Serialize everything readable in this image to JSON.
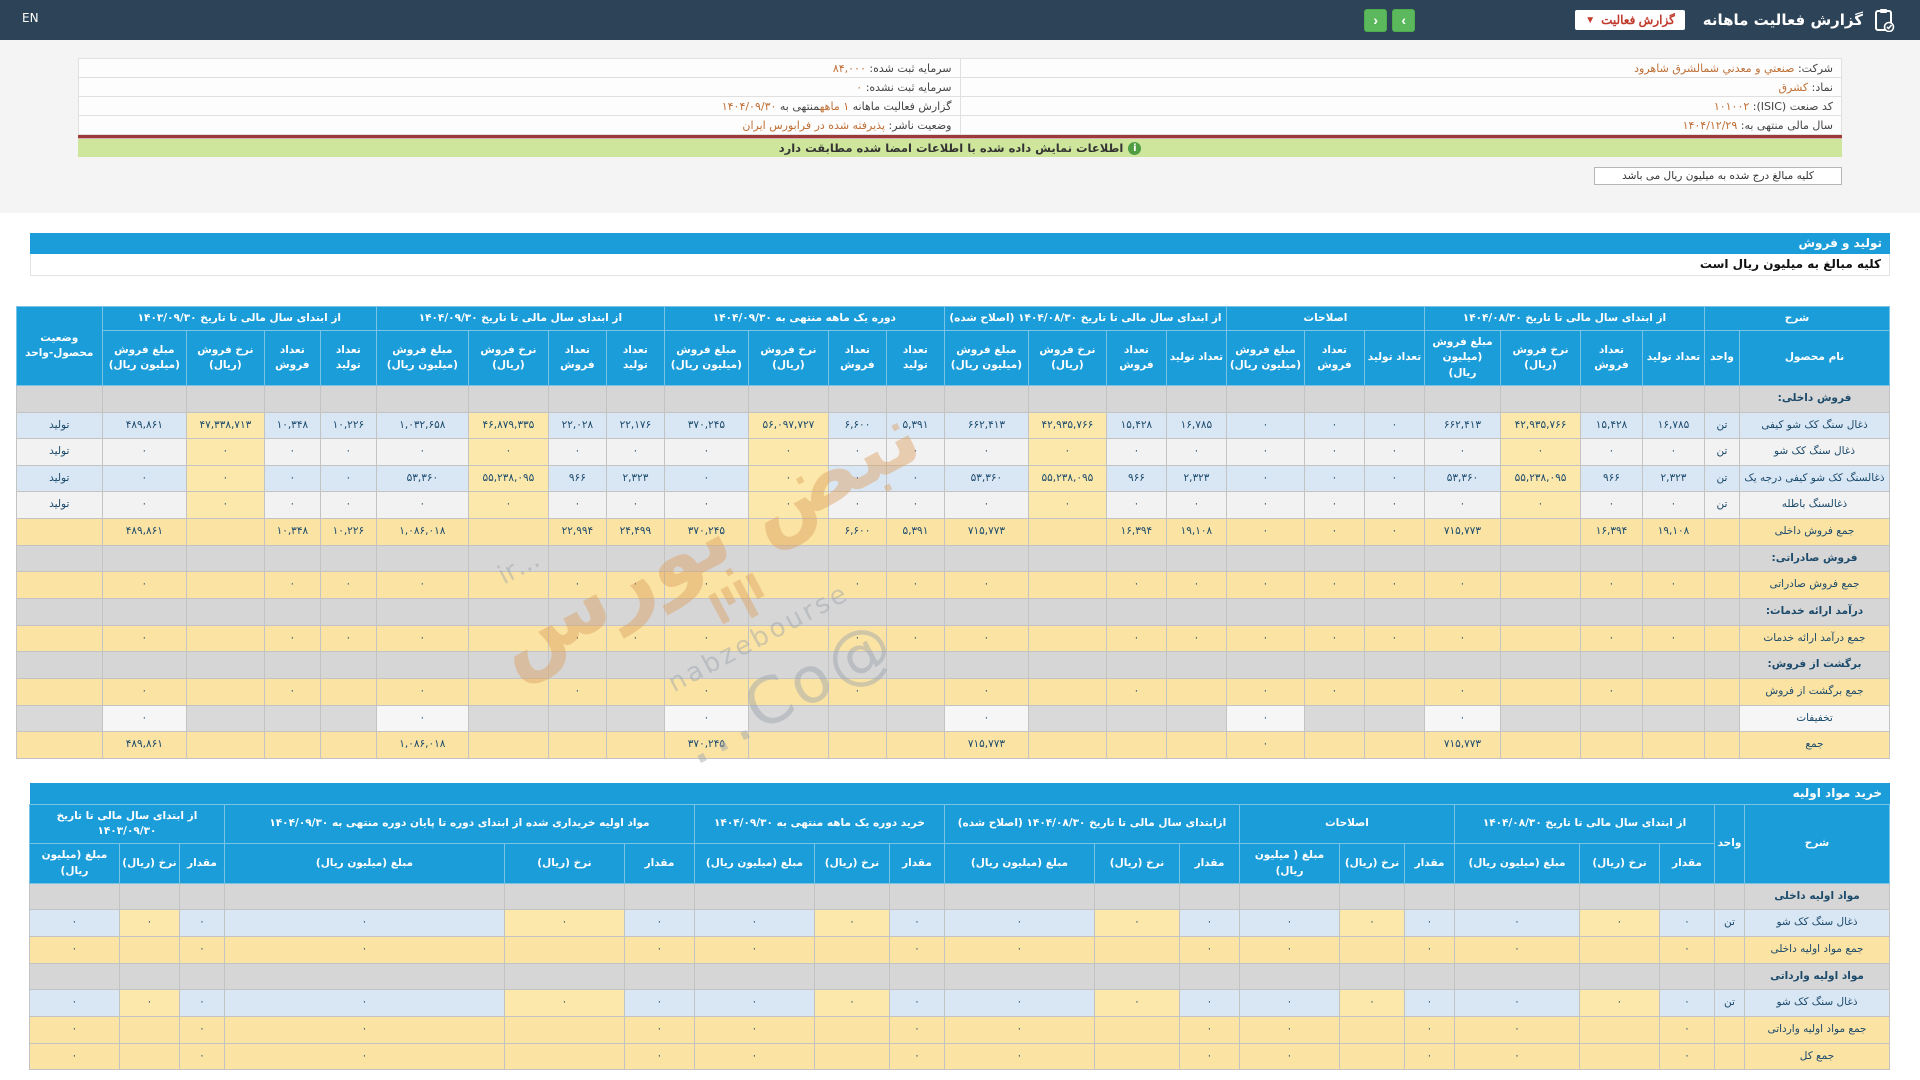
{
  "topbar": {
    "title": "گزارش فعالیت ماهانه",
    "dropdown_label": "گزارش فعالیت",
    "en_label": "EN",
    "next_label": "›",
    "prev_label": "‹"
  },
  "info": {
    "rows": [
      {
        "right": [
          [
            "شرکت:  ",
            0
          ],
          [
            "صنعتي و معدني شمالشرق شاهرود",
            1
          ]
        ],
        "left": [
          [
            "سرمایه ثبت شده:  ",
            0
          ],
          [
            "۸۴,۰۰۰",
            1
          ]
        ]
      },
      {
        "right": [
          [
            "نماد:  ",
            0
          ],
          [
            "کشرق",
            1
          ]
        ],
        "left": [
          [
            "سرمایه ثبت نشده:  ",
            0
          ],
          [
            "۰",
            1
          ]
        ]
      },
      {
        "right": [
          [
            "کد صنعت (ISIC):  ",
            0
          ],
          [
            "۱۰۱۰۰۲",
            1
          ]
        ],
        "left": [
          [
            "گزارش فعالیت ماهانه ",
            0
          ],
          [
            "۱ ماهه",
            1
          ],
          [
            "منتهی به ",
            0
          ],
          [
            "۱۴۰۴/۰۹/۳۰",
            1
          ]
        ]
      },
      {
        "right": [
          [
            "سال مالی منتهی به:  ",
            0
          ],
          [
            "۱۴۰۴/۱۲/۲۹",
            1
          ]
        ],
        "left": [
          [
            "وضعیت ناشر:  ",
            0
          ],
          [
            "پذیرفته شده در فرابورس ایران",
            1
          ]
        ]
      }
    ]
  },
  "notices": {
    "signed": "اطلاعات نمایش داده شده با اطلاعات امضا شده مطابقت دارد",
    "info_icon": "i",
    "unit_box": "کلیه مبالغ درج شده به میلیون ریال می باشد"
  },
  "watermark": {
    "ir": "...ir",
    "fa": "نبض بورس",
    "en": "nabzebourse",
    "at": "@Co..."
  },
  "tables": [
    {
      "title": "تولید و فروش",
      "subtitle": "کلیه مبالغ به میلیون ریال است",
      "has_status": true,
      "ncols": 23,
      "rate_cols": [
        2,
        9,
        13,
        17,
        21
      ],
      "amount_cols": [
        3,
        6,
        10,
        14,
        18,
        22
      ],
      "widths": [
        150,
        35,
        62,
        62,
        80,
        76,
        60,
        60,
        78,
        60,
        60,
        78,
        84,
        58,
        58,
        80,
        84,
        58,
        58,
        80,
        92,
        56,
        56,
        78,
        84,
        86
      ],
      "header": [
        [
          {
            "t": "شرح",
            "cs": 2
          },
          {
            "t": "از ابتدای سال مالی تا تاریخ ۱۴۰۴/۰۸/۳۰",
            "cs": 4
          },
          {
            "t": "اصلاحات",
            "cs": 3
          },
          {
            "t": "از ابتدای سال مالی تا تاریخ ۱۴۰۴/۰۸/۳۰ (اصلاح شده)",
            "cs": 4
          },
          {
            "t": "دوره یک ماهه منتهی به ۱۴۰۴/۰۹/۳۰",
            "cs": 4
          },
          {
            "t": "از ابتدای سال مالی تا تاریخ ۱۴۰۴/۰۹/۳۰",
            "cs": 4
          },
          {
            "t": "از ابتدای سال مالی تا تاریخ ۱۴۰۳/۰۹/۳۰",
            "cs": 4
          },
          {
            "t": "وضعیت محصول-واحد",
            "rs": 2
          }
        ],
        [
          {
            "t": "نام محصول"
          },
          {
            "t": "واحد"
          },
          {
            "t": "تعداد تولید"
          },
          {
            "t": "تعداد فروش"
          },
          {
            "t": "نرخ فروش (ریال)"
          },
          {
            "t": "مبلغ فروش (میلیون ریال)"
          },
          {
            "t": "تعداد تولید"
          },
          {
            "t": "تعداد فروش"
          },
          {
            "t": "مبلغ فروش (میلیون ریال)"
          },
          {
            "t": "تعداد تولید"
          },
          {
            "t": "تعداد فروش"
          },
          {
            "t": "نرخ فروش (ریال)"
          },
          {
            "t": "مبلغ فروش (میلیون ریال)"
          },
          {
            "t": "تعداد تولید"
          },
          {
            "t": "تعداد فروش"
          },
          {
            "t": "نرخ فروش (ریال)"
          },
          {
            "t": "مبلغ فروش (میلیون ریال)"
          },
          {
            "t": "تعداد تولید"
          },
          {
            "t": "تعداد فروش"
          },
          {
            "t": "نرخ فروش (ریال)"
          },
          {
            "t": "مبلغ فروش (میلیون ریال)"
          },
          {
            "t": "تعداد تولید"
          },
          {
            "t": "تعداد فروش"
          },
          {
            "t": "نرخ فروش (ریال)"
          },
          {
            "t": "مبلغ فروش (میلیون ریال)"
          }
        ]
      ],
      "rows": [
        {
          "type": "section",
          "label": "فروش داخلی:"
        },
        {
          "type": "product",
          "shade": "b",
          "name": "ذغال سنگ کک شو کیفی",
          "unit": "تن",
          "status": "تولید",
          "cells": [
            "۱۶,۷۸۵",
            "۱۵,۴۲۸",
            "۴۲,۹۳۵,۷۶۶",
            "۶۶۲,۴۱۳",
            "۰",
            "۰",
            "۰",
            "۱۶,۷۸۵",
            "۱۵,۴۲۸",
            "۴۲,۹۳۵,۷۶۶",
            "۶۶۲,۴۱۳",
            "۵,۳۹۱",
            "۶,۶۰۰",
            "۵۶,۰۹۷,۷۲۷",
            "۳۷۰,۲۴۵",
            "۲۲,۱۷۶",
            "۲۲,۰۲۸",
            "۴۶,۸۷۹,۳۳۵",
            "۱,۰۳۲,۶۵۸",
            "۱۰,۲۲۶",
            "۱۰,۳۴۸",
            "۴۷,۳۳۸,۷۱۳",
            "۴۸۹,۸۶۱"
          ]
        },
        {
          "type": "product",
          "shade": "a",
          "name": "ذغال سنگ کک شو",
          "unit": "تن",
          "status": "تولید",
          "cells": [
            "۰",
            "۰",
            "۰",
            "۰",
            "۰",
            "۰",
            "۰",
            "۰",
            "۰",
            "۰",
            "۰",
            "۰",
            "۰",
            "۰",
            "۰",
            "۰",
            "۰",
            "۰",
            "۰",
            "۰",
            "۰",
            "۰",
            "۰"
          ]
        },
        {
          "type": "product",
          "shade": "b",
          "name": "ذغالسنگ کک شو کیفی درجه یک",
          "unit": "تن",
          "status": "تولید",
          "cells": [
            "۲,۳۲۳",
            "۹۶۶",
            "۵۵,۲۳۸,۰۹۵",
            "۵۳,۳۶۰",
            "۰",
            "۰",
            "۰",
            "۲,۳۲۳",
            "۹۶۶",
            "۵۵,۲۳۸,۰۹۵",
            "۵۳,۳۶۰",
            "۰",
            "۰",
            "۰",
            "۰",
            "۲,۳۲۳",
            "۹۶۶",
            "۵۵,۲۳۸,۰۹۵",
            "۵۳,۳۶۰",
            "۰",
            "۰",
            "۰",
            "۰"
          ]
        },
        {
          "type": "product",
          "shade": "a",
          "name": "ذغالسنگ باطله",
          "unit": "تن",
          "status": "تولید",
          "cells": [
            "۰",
            "۰",
            "۰",
            "۰",
            "۰",
            "۰",
            "۰",
            "۰",
            "۰",
            "۰",
            "۰",
            "۰",
            "۰",
            "۰",
            "۰",
            "۰",
            "۰",
            "۰",
            "۰",
            "۰",
            "۰",
            "۰",
            "۰"
          ]
        },
        {
          "type": "sum",
          "name": "جمع فروش داخلی",
          "cells": [
            "۱۹,۱۰۸",
            "۱۶,۳۹۴",
            "",
            "۷۱۵,۷۷۳",
            "۰",
            "۰",
            "۰",
            "۱۹,۱۰۸",
            "۱۶,۳۹۴",
            "",
            "۷۱۵,۷۷۳",
            "۵,۳۹۱",
            "۶,۶۰۰",
            "",
            "۳۷۰,۲۴۵",
            "۲۴,۴۹۹",
            "۲۲,۹۹۴",
            "",
            "۱,۰۸۶,۰۱۸",
            "۱۰,۲۲۶",
            "۱۰,۳۴۸",
            "",
            "۴۸۹,۸۶۱"
          ]
        },
        {
          "type": "section",
          "label": "فروش صادراتی:"
        },
        {
          "type": "sum",
          "name": "جمع فروش صادراتی",
          "cells": [
            "۰",
            "۰",
            "",
            "۰",
            "۰",
            "۰",
            "۰",
            "۰",
            "۰",
            "",
            "۰",
            "۰",
            "۰",
            "",
            "۰",
            "۰",
            "۰",
            "",
            "۰",
            "۰",
            "۰",
            "",
            "۰"
          ]
        },
        {
          "type": "section",
          "label": "درآمد ارائه خدمات:"
        },
        {
          "type": "sum",
          "name": "جمع درآمد ارائه خدمات",
          "cells": [
            "۰",
            "۰",
            "",
            "۰",
            "۰",
            "۰",
            "۰",
            "۰",
            "۰",
            "",
            "۰",
            "۰",
            "۰",
            "",
            "۰",
            "۰",
            "۰",
            "",
            "۰",
            "۰",
            "۰",
            "",
            "۰"
          ]
        },
        {
          "type": "section",
          "label": "برگشت از فروش:"
        },
        {
          "type": "sum",
          "name": "جمع برگشت از فروش",
          "cells": [
            "",
            "۰",
            "",
            "۰",
            "",
            "۰",
            "۰",
            "",
            "۰",
            "",
            "۰",
            "",
            "۰",
            "",
            "۰",
            "",
            "۰",
            "",
            "۰",
            "",
            "۰",
            "",
            "۰"
          ]
        },
        {
          "type": "disc",
          "name": "تخفیفات",
          "cells": [
            "",
            "",
            "",
            "۰",
            "",
            "",
            "۰",
            "",
            "",
            "",
            "۰",
            "",
            "",
            "",
            "۰",
            "",
            "",
            "",
            "۰",
            "",
            "",
            "",
            "۰"
          ]
        },
        {
          "type": "sum",
          "name": "جمع",
          "cells": [
            "",
            "",
            "",
            "۷۱۵,۷۷۳",
            "",
            "",
            "۰",
            "",
            "",
            "",
            "۷۱۵,۷۷۳",
            "",
            "",
            "",
            "۳۷۰,۲۴۵",
            "",
            "",
            "",
            "۱,۰۸۶,۰۱۸",
            "",
            "",
            "",
            "۴۸۹,۸۶۱"
          ]
        }
      ]
    },
    {
      "title": "خرید مواد اولیه",
      "subtitle": "",
      "has_status": false,
      "ncols": 18,
      "rate_cols": [
        1,
        4,
        7,
        10,
        13,
        16
      ],
      "amount_cols": [
        2,
        5,
        8,
        11,
        14,
        17
      ],
      "widths": [
        145,
        30,
        55,
        80,
        125,
        50,
        65,
        100,
        60,
        85,
        150,
        55,
        75,
        120,
        70,
        120,
        280,
        45,
        60,
        90
      ],
      "header": [
        [
          {
            "t": "شرح",
            "rs": 2
          },
          {
            "t": "واحد",
            "rs": 2
          },
          {
            "t": "از ابتدای سال مالی تا تاریخ ۱۴۰۴/۰۸/۳۰",
            "cs": 3
          },
          {
            "t": "اصلاحات",
            "cs": 3
          },
          {
            "t": "ازابتدای سال مالی تا تاریخ ۱۴۰۴/۰۸/۳۰ (اصلاح شده)",
            "cs": 3
          },
          {
            "t": "خرید دوره یک ماهه منتهی به ۱۴۰۴/۰۹/۳۰",
            "cs": 3
          },
          {
            "t": "مواد اولیه خریداری شده از ابتدای دوره تا پایان دوره منتهی به ۱۴۰۴/۰۹/۳۰",
            "cs": 3
          },
          {
            "t": "از ابتدای سال مالی تا تاریخ ۱۴۰۳/۰۹/۳۰",
            "cs": 3
          }
        ],
        [
          {
            "t": "مقدار"
          },
          {
            "t": "نرخ (ریال)"
          },
          {
            "t": "مبلغ (میلیون ریال)"
          },
          {
            "t": "مقدار"
          },
          {
            "t": "نرخ (ریال)"
          },
          {
            "t": "مبلغ ( میلیون ریال)"
          },
          {
            "t": "مقدار"
          },
          {
            "t": "نرخ (ریال)"
          },
          {
            "t": "مبلغ (میلیون ریال)"
          },
          {
            "t": "مقدار"
          },
          {
            "t": "نرخ (ریال)"
          },
          {
            "t": "مبلغ (میلیون ریال)"
          },
          {
            "t": "مقدار"
          },
          {
            "t": "نرخ (ریال)"
          },
          {
            "t": "مبلغ (میلیون ریال)"
          },
          {
            "t": "مقدار"
          },
          {
            "t": "نرخ (ریال)"
          },
          {
            "t": "مبلغ (میلیون ریال)"
          }
        ]
      ],
      "rows": [
        {
          "type": "section",
          "label": "مواد اولیه داخلی"
        },
        {
          "type": "product",
          "shade": "b",
          "name": "ذغال سنگ کک شو",
          "unit": "تن",
          "cells": [
            "۰",
            "۰",
            "۰",
            "۰",
            "۰",
            "۰",
            "۰",
            "۰",
            "۰",
            "۰",
            "۰",
            "۰",
            "۰",
            "۰",
            "۰",
            "۰",
            "۰",
            "۰"
          ]
        },
        {
          "type": "sum",
          "name": "جمع مواد اولیه داخلی",
          "cells": [
            "۰",
            "",
            "۰",
            "۰",
            "",
            "۰",
            "۰",
            "",
            "۰",
            "۰",
            "",
            "۰",
            "۰",
            "",
            "۰",
            "۰",
            "",
            "۰"
          ]
        },
        {
          "type": "section",
          "label": "مواد اولیه وارداتی"
        },
        {
          "type": "product",
          "shade": "b",
          "name": "ذغال سنگ کک شو",
          "unit": "تن",
          "cells": [
            "۰",
            "۰",
            "۰",
            "۰",
            "۰",
            "۰",
            "۰",
            "۰",
            "۰",
            "۰",
            "۰",
            "۰",
            "۰",
            "۰",
            "۰",
            "۰",
            "۰",
            "۰"
          ]
        },
        {
          "type": "sum",
          "name": "جمع مواد اولیه وارداتی",
          "cells": [
            "۰",
            "",
            "۰",
            "۰",
            "",
            "۰",
            "۰",
            "",
            "۰",
            "۰",
            "",
            "۰",
            "۰",
            "",
            "۰",
            "۰",
            "",
            "۰"
          ]
        },
        {
          "type": "sum",
          "name": "جمع کل",
          "cells": [
            "۰",
            "",
            "۰",
            "۰",
            "",
            "۰",
            "۰",
            "",
            "۰",
            "۰",
            "",
            "۰",
            "۰",
            "",
            "۰",
            "۰",
            "",
            "۰"
          ]
        }
      ]
    }
  ]
}
